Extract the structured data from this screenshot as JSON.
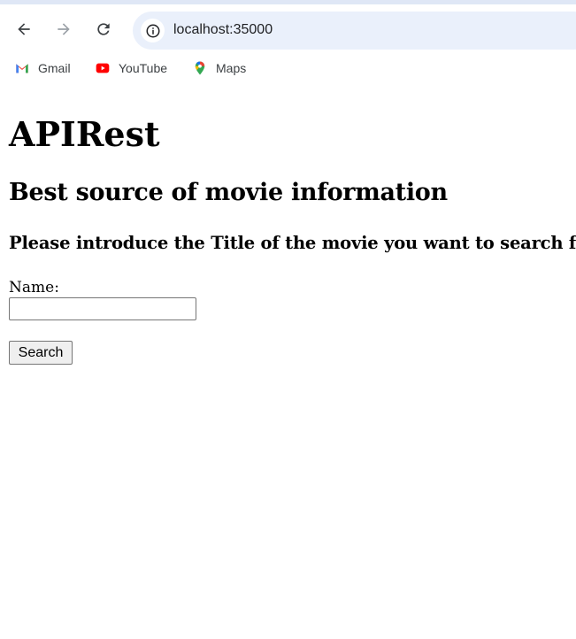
{
  "browser": {
    "url": "localhost:35000",
    "nav_icons": [
      "back-arrow-icon",
      "forward-arrow-icon",
      "reload-icon",
      "site-info-icon"
    ],
    "bookmarks": [
      {
        "label": "Gmail",
        "icon": "gmail-icon"
      },
      {
        "label": "YouTube",
        "icon": "youtube-icon"
      },
      {
        "label": "Maps",
        "icon": "maps-icon"
      }
    ],
    "colors": {
      "omnibox_bg": "#eaf0fb",
      "youtube_red": "#ff0000",
      "gmail_red": "#ea4335"
    }
  },
  "page": {
    "title": "APIRest",
    "subtitle": "Best source of movie information",
    "instruction": "Please introduce the Title of the movie you want to search for",
    "form": {
      "name_label": "Name:",
      "name_value": "",
      "search_button": "Search"
    }
  }
}
